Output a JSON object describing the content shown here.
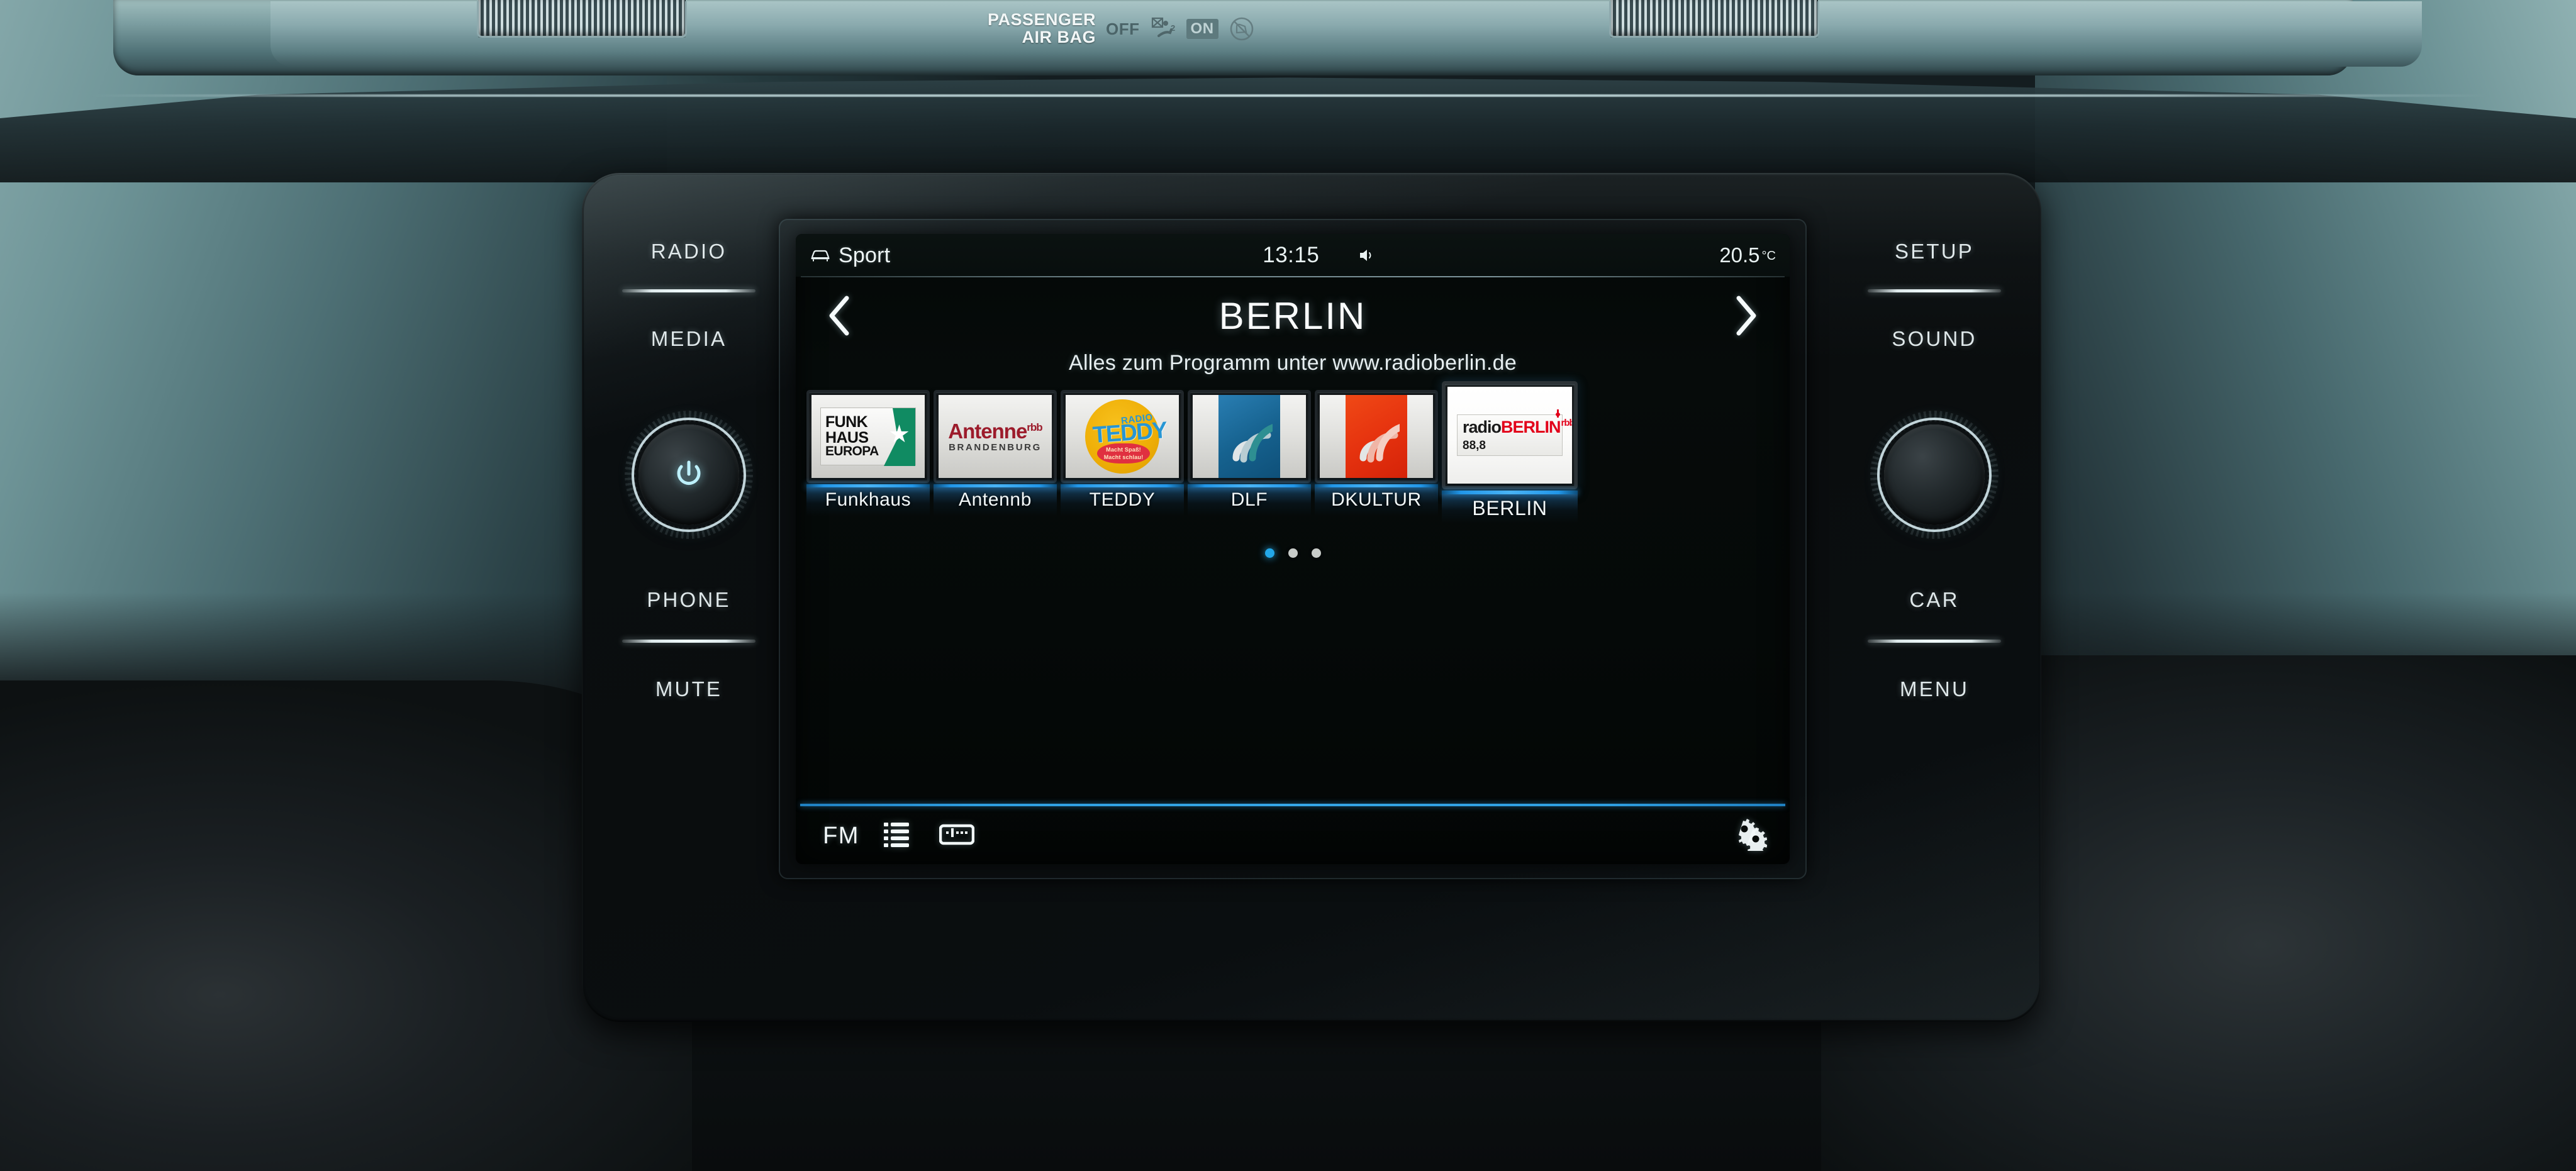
{
  "dashboard": {
    "airbag": {
      "title_line1": "PASSENGER",
      "title_line2": "AIR BAG",
      "off_label": "OFF",
      "on_label": "ON"
    },
    "left_buttons": [
      {
        "label": "RADIO"
      },
      {
        "label": "MEDIA"
      },
      {
        "label": "PHONE"
      },
      {
        "label": "MUTE"
      }
    ],
    "right_buttons": [
      {
        "label": "SETUP"
      },
      {
        "label": "SOUND"
      },
      {
        "label": "CAR"
      },
      {
        "label": "MENU"
      }
    ],
    "left_knob": {
      "icon": "power-icon"
    },
    "right_knob": {
      "icon": "knob"
    }
  },
  "screen": {
    "statusbar": {
      "profile_icon": "car-icon",
      "profile": "Sport",
      "clock": "13:15",
      "mute_icon": "speaker-mute-icon",
      "temperature": "20.5",
      "temperature_unit": "°C"
    },
    "header": {
      "prev_icon": "chevron-left-icon",
      "next_icon": "chevron-right-icon",
      "station_name": "BERLIN"
    },
    "radiotext": "Alles zum Programm unter www.radioberlin.de",
    "presets": [
      {
        "label": "Funkhaus",
        "selected": false,
        "logo": "funkhaus-europa-logo",
        "logo_text": {
          "line1": "FUNK",
          "line2": "HAUS",
          "line3": "EUROPA"
        }
      },
      {
        "label": "Antennb",
        "selected": false,
        "logo": "antenne-brandenburg-logo",
        "logo_text": {
          "main": "Antenne",
          "sup": "rbb",
          "sub": "BRANDENBURG"
        }
      },
      {
        "label": "TEDDY",
        "selected": false,
        "logo": "radio-teddy-logo",
        "logo_text": {
          "radio": "RADIO",
          "name": "TEDDY",
          "slogan1": "Macht Spaß!",
          "slogan2": "Macht schlau!"
        }
      },
      {
        "label": "DLF",
        "selected": false,
        "logo": "deutschlandfunk-wave-logo",
        "logo_text": {}
      },
      {
        "label": "DKULTUR",
        "selected": false,
        "logo": "deutschlandfunk-kultur-wave-logo",
        "logo_text": {}
      },
      {
        "label": "BERLIN",
        "selected": true,
        "logo": "radio-berlin-rbb-logo",
        "logo_text": {
          "radio": "radio",
          "berlin": "BERLIN",
          "rbb": "rbb",
          "freq": "88,8"
        }
      }
    ],
    "pagination": {
      "count": 3,
      "active_index": 0
    },
    "bottombar": {
      "band_label": "FM",
      "list_icon": "list-icon",
      "band_scan_icon": "tuner-band-icon",
      "settings_icon": "gears-icon"
    }
  },
  "colors": {
    "accent_blue": "#35a6e6",
    "tile_underline": "#2196e8",
    "screen_bg": "#050908",
    "text_primary": "#f2f9fa",
    "teddy_yellow": "#eeae06",
    "teddy_blue": "#2796d4",
    "teddy_red": "#e03040",
    "antenne_red": "#9c1b2b",
    "berlin_red": "#e2001a",
    "funkhaus_green": "#108b62",
    "dlf_blue": "#16628f",
    "dkultur_red": "#e6330f"
  }
}
